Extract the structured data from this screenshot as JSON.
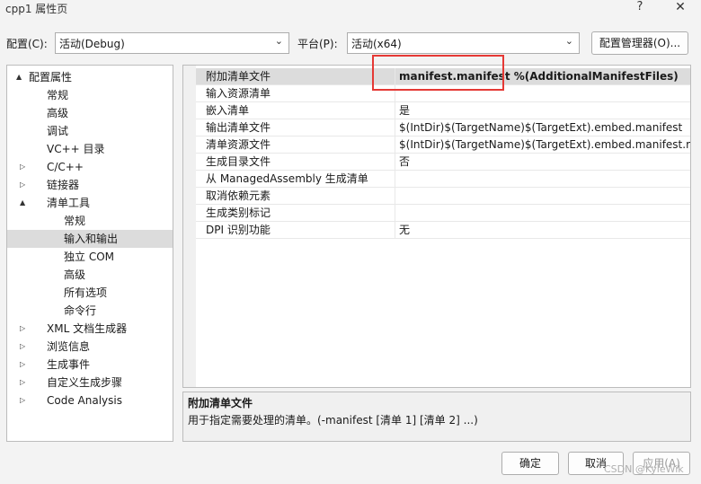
{
  "window": {
    "title": "cpp1 属性页",
    "help": "?",
    "close": "✕"
  },
  "toolbar": {
    "config_label": "配置(C):",
    "config_value": "活动(Debug)",
    "platform_label": "平台(P):",
    "platform_value": "活动(x64)",
    "config_manager": "配置管理器(O)..."
  },
  "tree": [
    {
      "label": "配置属性",
      "level": 0,
      "arrow": "▲"
    },
    {
      "label": "常规",
      "level": 1,
      "arrow": ""
    },
    {
      "label": "高级",
      "level": 1,
      "arrow": ""
    },
    {
      "label": "调试",
      "level": 1,
      "arrow": ""
    },
    {
      "label": "VC++ 目录",
      "level": 1,
      "arrow": ""
    },
    {
      "label": "C/C++",
      "level": 1,
      "arrow": "▷"
    },
    {
      "label": "链接器",
      "level": 1,
      "arrow": "▷"
    },
    {
      "label": "清单工具",
      "level": 1,
      "arrow": "▲"
    },
    {
      "label": "常规",
      "level": 2,
      "arrow": ""
    },
    {
      "label": "输入和输出",
      "level": 2,
      "arrow": "",
      "selected": true
    },
    {
      "label": "独立 COM",
      "level": 2,
      "arrow": ""
    },
    {
      "label": "高级",
      "level": 2,
      "arrow": ""
    },
    {
      "label": "所有选项",
      "level": 2,
      "arrow": ""
    },
    {
      "label": "命令行",
      "level": 2,
      "arrow": ""
    },
    {
      "label": "XML 文档生成器",
      "level": 1,
      "arrow": "▷"
    },
    {
      "label": "浏览信息",
      "level": 1,
      "arrow": "▷"
    },
    {
      "label": "生成事件",
      "level": 1,
      "arrow": "▷"
    },
    {
      "label": "自定义生成步骤",
      "level": 1,
      "arrow": "▷"
    },
    {
      "label": "Code Analysis",
      "level": 1,
      "arrow": "▷"
    }
  ],
  "properties": [
    {
      "name": "附加清单文件",
      "value": "manifest.manifest %(AdditionalManifestFiles)",
      "selected": true
    },
    {
      "name": "输入资源清单",
      "value": ""
    },
    {
      "name": "嵌入清单",
      "value": "是"
    },
    {
      "name": "输出清单文件",
      "value": "$(IntDir)$(TargetName)$(TargetExt).embed.manifest"
    },
    {
      "name": "清单资源文件",
      "value": "$(IntDir)$(TargetName)$(TargetExt).embed.manifest.res"
    },
    {
      "name": "生成目录文件",
      "value": "否"
    },
    {
      "name": "从 ManagedAssembly 生成清单",
      "value": ""
    },
    {
      "name": "取消依赖元素",
      "value": ""
    },
    {
      "name": "生成类别标记",
      "value": ""
    },
    {
      "name": "DPI 识别功能",
      "value": "无"
    }
  ],
  "description": {
    "title": "附加清单文件",
    "body": "用于指定需要处理的清单。(-manifest [清单 1] [清单 2] ...)"
  },
  "buttons": {
    "ok": "确定",
    "cancel": "取消",
    "apply": "应用(A)"
  },
  "watermark": "CSDN @KyleWik",
  "colors": {
    "highlight": "#e53935",
    "selection": "#dcdcdc"
  }
}
